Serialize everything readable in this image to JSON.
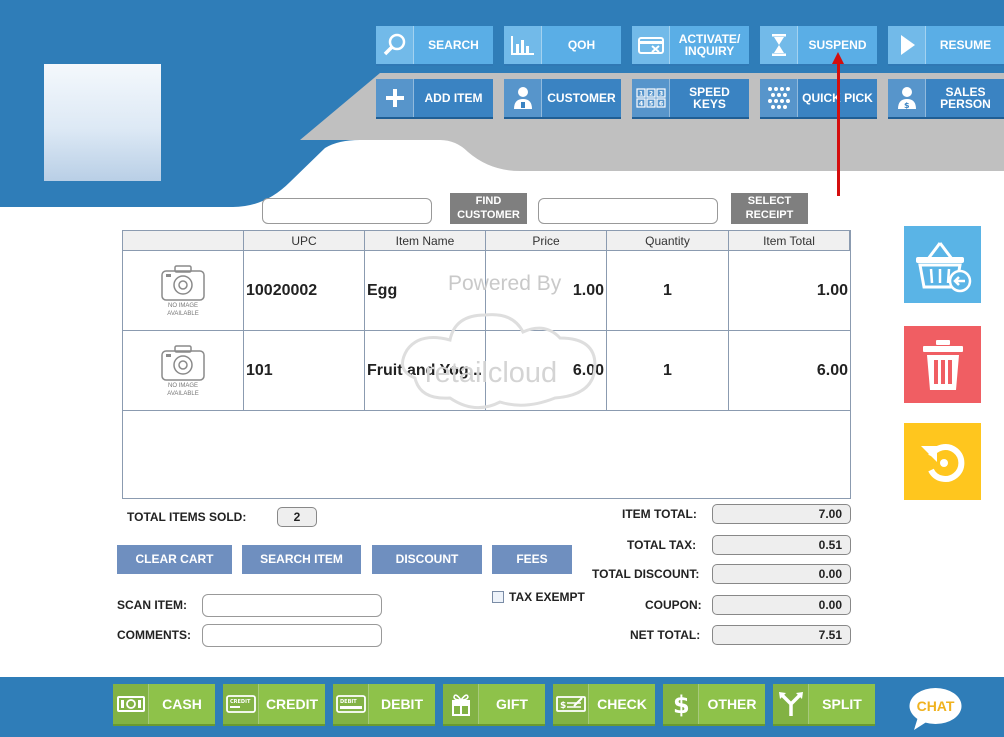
{
  "top_buttons_row1": [
    {
      "label": "SEARCH",
      "icon": "magnifier-icon"
    },
    {
      "label": "QOH",
      "icon": "bar-chart-icon"
    },
    {
      "label": "ACTIVATE/\nINQUIRY",
      "icon": "card-inquiry-icon"
    },
    {
      "label": "SUSPEND",
      "icon": "hourglass-icon"
    },
    {
      "label": "RESUME",
      "icon": "play-icon"
    }
  ],
  "top_buttons_row2": [
    {
      "label": "ADD ITEM",
      "icon": "plus-icon"
    },
    {
      "label": "CUSTOMER",
      "icon": "customer-icon"
    },
    {
      "label": "SPEED KEYS",
      "icon": "keypad-icon"
    },
    {
      "label": "QUICK PICK",
      "icon": "grid-dots-icon"
    },
    {
      "label": "SALES\nPERSON",
      "icon": "salesperson-icon"
    }
  ],
  "search": {
    "find_customer_label": "FIND\nCUSTOMER",
    "select_receipt_label": "SELECT\nRECEIPT",
    "customer_value": "",
    "receipt_value": ""
  },
  "grid": {
    "columns": [
      "",
      "UPC",
      "Item Name",
      "Price",
      "Quantity",
      "Item Total"
    ],
    "no_image_text": "NO IMAGE\nAVAILABLE",
    "rows": [
      {
        "upc": "10020002",
        "name": "Egg",
        "price": "1.00",
        "qty": "1",
        "total": "1.00"
      },
      {
        "upc": "101",
        "name": "Fruit and Yog...",
        "price": "6.00",
        "qty": "1",
        "total": "6.00"
      }
    ],
    "watermark_top": "Powered By",
    "watermark_brand": "retailcloud"
  },
  "side_actions": [
    {
      "name": "return-basket-icon",
      "color": "#5ab4e6"
    },
    {
      "name": "trash-icon",
      "color": "#f05e63"
    },
    {
      "name": "undo-icon",
      "color": "#ffc61e"
    }
  ],
  "summary": {
    "total_items_sold_label": "TOTAL ITEMS SOLD:",
    "total_items_sold": "2",
    "item_total_label": "ITEM TOTAL:",
    "item_total": "7.00",
    "total_tax_label": "TOTAL TAX:",
    "total_tax": "0.51",
    "total_discount_label": "TOTAL DISCOUNT:",
    "total_discount": "0.00",
    "coupon_label": "COUPON:",
    "coupon": "0.00",
    "net_total_label": "NET TOTAL:",
    "net_total": "7.51"
  },
  "actions": {
    "clear_cart": "CLEAR CART",
    "search_item": "SEARCH ITEM",
    "discount": "DISCOUNT",
    "fees": "FEES",
    "tax_exempt": "TAX EXEMPT"
  },
  "fields": {
    "scan_item_label": "SCAN ITEM:",
    "scan_item_value": "",
    "comments_label": "COMMENTS:",
    "comments_value": ""
  },
  "payments": [
    {
      "label": "CASH",
      "icon": "cash-icon"
    },
    {
      "label": "CREDIT",
      "icon": "credit-card-icon"
    },
    {
      "label": "DEBIT",
      "icon": "debit-card-icon"
    },
    {
      "label": "GIFT",
      "icon": "gift-icon"
    },
    {
      "label": "CHECK",
      "icon": "check-icon"
    },
    {
      "label": "OTHER",
      "icon": "dollar-icon"
    },
    {
      "label": "SPLIT",
      "icon": "split-icon"
    }
  ],
  "chat_label": "CHAT",
  "colors": {
    "header_blue": "#2f7db8",
    "button_light_blue": "#5aaee6",
    "button_blue": "#3a83c2",
    "payment_green": "#8ec24a",
    "annotation_red": "#d40e0e"
  }
}
